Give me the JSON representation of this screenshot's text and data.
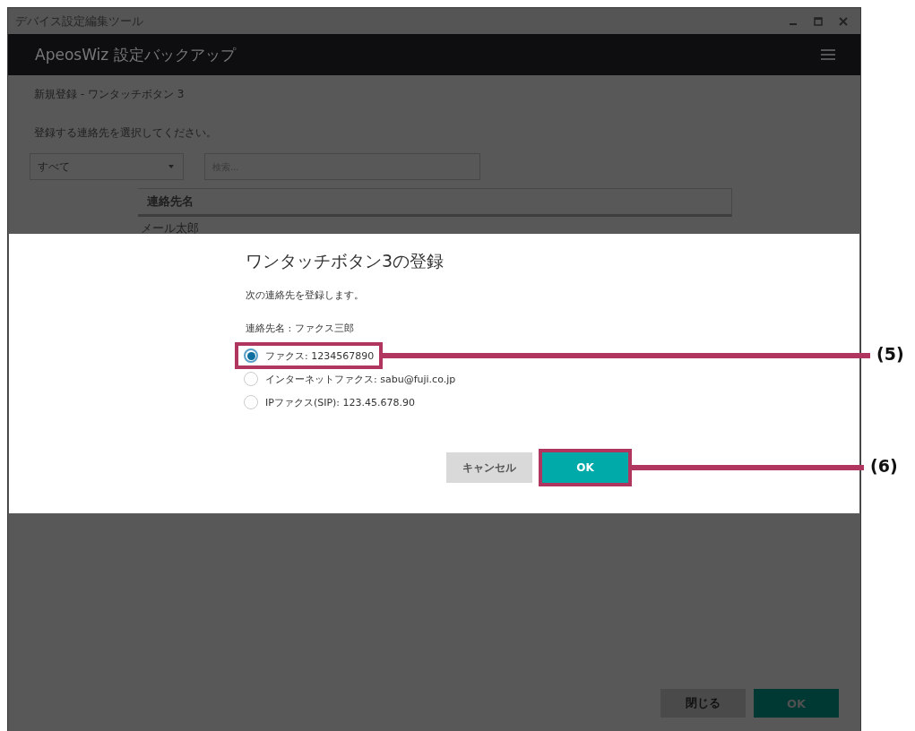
{
  "window": {
    "title": "デバイス設定編集ツール"
  },
  "header": {
    "title": "ApeosWiz 設定バックアップ"
  },
  "page": {
    "heading": "新規登録 - ワンタッチボタン 3",
    "instruction": "登録する連絡先を選択してください。",
    "filter": {
      "value": "すべて"
    },
    "search": {
      "placeholder": "検索..."
    },
    "table": {
      "columns": [
        "連絡先名"
      ],
      "rows": [
        [
          "メール太郎"
        ]
      ]
    },
    "buttons": [
      {
        "label": "閉じる",
        "kind": "secondary"
      },
      {
        "label": "OK",
        "kind": "primary"
      }
    ]
  },
  "dialog": {
    "title": "ワンタッチボタン3の登録",
    "message": "次の連絡先を登録します。",
    "contact": "連絡先名 : ファクス三郎",
    "options": [
      {
        "label": "ファクス: 1234567890",
        "selected": true,
        "callout": "(5)"
      },
      {
        "label": "インターネットファクス: sabu@fuji.co.jp",
        "selected": false
      },
      {
        "label": "IPファクス(SIP): 123.45.678.90",
        "selected": false
      }
    ],
    "buttons": [
      {
        "label": "キャンセル",
        "kind": "secondary"
      },
      {
        "label": "OK",
        "kind": "primary",
        "callout": "(6)"
      }
    ]
  }
}
